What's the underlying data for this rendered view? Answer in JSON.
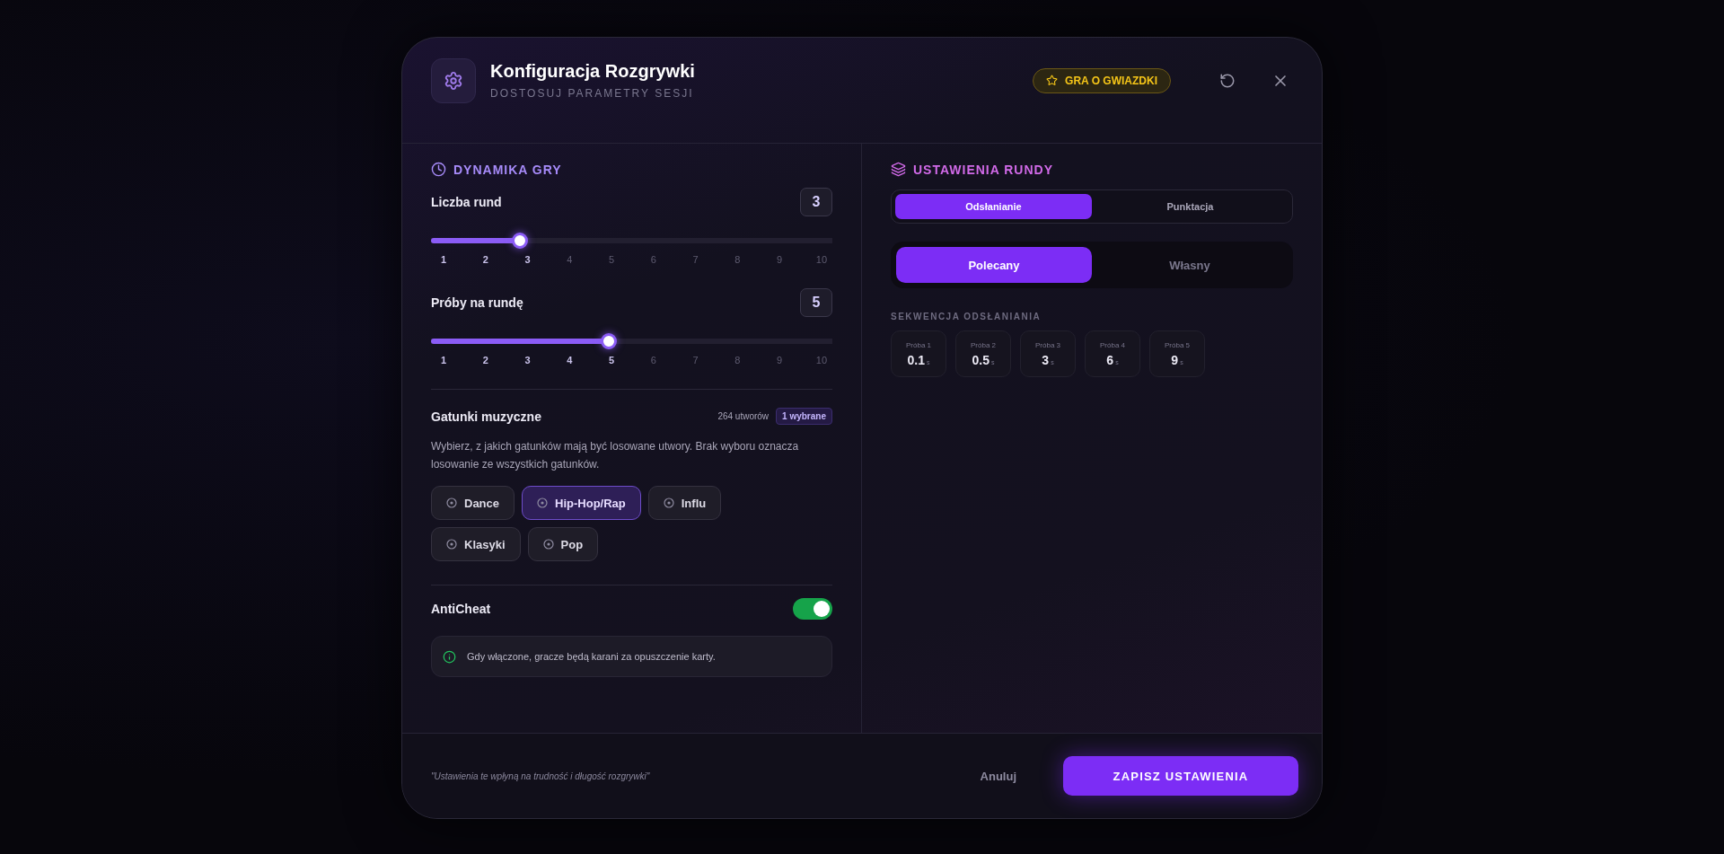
{
  "header": {
    "title": "Konfiguracja Rozgrywki",
    "subtitle": "DOSTOSUJ PARAMETRY SESJI",
    "badge": "GRA O GWIAZDKI"
  },
  "game_dynamics": {
    "heading": "DYNAMIKA GRY",
    "sliders": [
      {
        "label": "Liczba rund",
        "value": "3",
        "level": 0.222,
        "ticks": [
          {
            "label": "1",
            "active": true
          },
          {
            "label": "2",
            "active": true
          },
          {
            "label": "3",
            "active": true
          },
          {
            "label": "4",
            "active": false
          },
          {
            "label": "5",
            "active": false
          },
          {
            "label": "6",
            "active": false
          },
          {
            "label": "7",
            "active": false
          },
          {
            "label": "8",
            "active": false
          },
          {
            "label": "9",
            "active": false
          },
          {
            "label": "10",
            "active": false
          }
        ]
      },
      {
        "label": "Próby na rundę",
        "value": "5",
        "level": 0.444,
        "ticks": [
          {
            "label": "1",
            "active": true
          },
          {
            "label": "2",
            "active": true
          },
          {
            "label": "3",
            "active": true
          },
          {
            "label": "4",
            "active": true
          },
          {
            "label": "5",
            "active": true
          },
          {
            "label": "6",
            "active": false
          },
          {
            "label": "7",
            "active": false
          },
          {
            "label": "8",
            "active": false
          },
          {
            "label": "9",
            "active": false
          },
          {
            "label": "10",
            "active": false
          }
        ]
      }
    ]
  },
  "genres": {
    "title": "Gatunki muzyczne",
    "count": "264 utworów",
    "selected_badge": "1 wybrane",
    "description": "Wybierz, z jakich gatunków mają być losowane utwory. Brak wyboru oznacza losowanie ze wszystkich gatunków.",
    "items": [
      {
        "label": "Dance",
        "selected": false
      },
      {
        "label": "Hip-Hop/Rap",
        "selected": true
      },
      {
        "label": "Influ",
        "selected": false
      },
      {
        "label": "Klasyki",
        "selected": false
      },
      {
        "label": "Pop",
        "selected": false
      }
    ]
  },
  "anticheat": {
    "label": "AntiCheat",
    "on": true,
    "info": "Gdy włączone, gracze będą karani za opuszczenie karty."
  },
  "round_settings": {
    "heading": "USTAWIENIA RUNDY",
    "tabs": [
      {
        "label": "Odsłanianie",
        "selected": true
      },
      {
        "label": "Punktacja",
        "selected": false
      }
    ],
    "modes": [
      {
        "label": "Polecany",
        "selected": true
      },
      {
        "label": "Własny",
        "selected": false
      }
    ],
    "sequence_label": "SEKWENCJA ODSŁANIANIA",
    "sequence": [
      {
        "label": "Próba 1",
        "value": "0.1",
        "unit": "s"
      },
      {
        "label": "Próba 2",
        "value": "0.5",
        "unit": "s"
      },
      {
        "label": "Próba 3",
        "value": "3",
        "unit": "s"
      },
      {
        "label": "Próba 4",
        "value": "6",
        "unit": "s"
      },
      {
        "label": "Próba 5",
        "value": "9",
        "unit": "s"
      }
    ]
  },
  "footer": {
    "note": "\"Ustawienia te wpłyną na trudność i długość rozgrywki\"",
    "cancel": "Anuluj",
    "save": "ZAPISZ USTAWIENIA"
  }
}
